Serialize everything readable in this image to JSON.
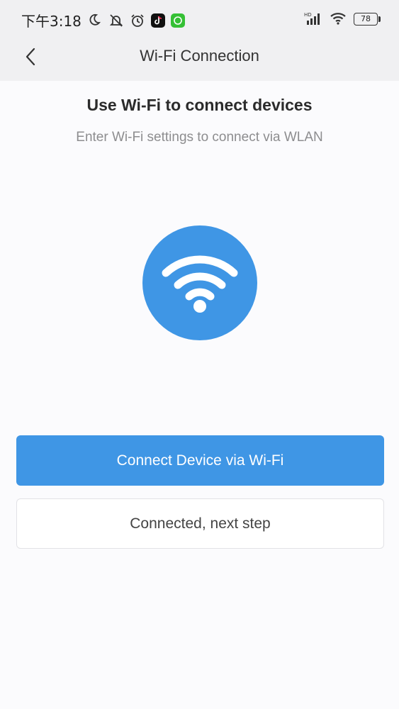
{
  "status_bar": {
    "time": "下午3:18",
    "battery_level": "78",
    "icons_left": [
      "moon-icon",
      "mute-icon",
      "alarm-icon",
      "tiktok-icon",
      "wechat-icon"
    ],
    "icons_right": [
      "hd-icon",
      "signal-icon",
      "wifi-icon",
      "battery-icon"
    ]
  },
  "nav": {
    "title": "Wi-Fi Connection",
    "back_icon": "chevron-left-icon"
  },
  "main": {
    "heading": "Use Wi-Fi to connect devices",
    "subheading": "Enter Wi-Fi settings to connect via WLAN",
    "illustration_icon": "wifi-icon",
    "accent_color": "#3f96e5"
  },
  "actions": {
    "primary_label": "Connect Device via Wi-Fi",
    "secondary_label": "Connected, next step"
  }
}
